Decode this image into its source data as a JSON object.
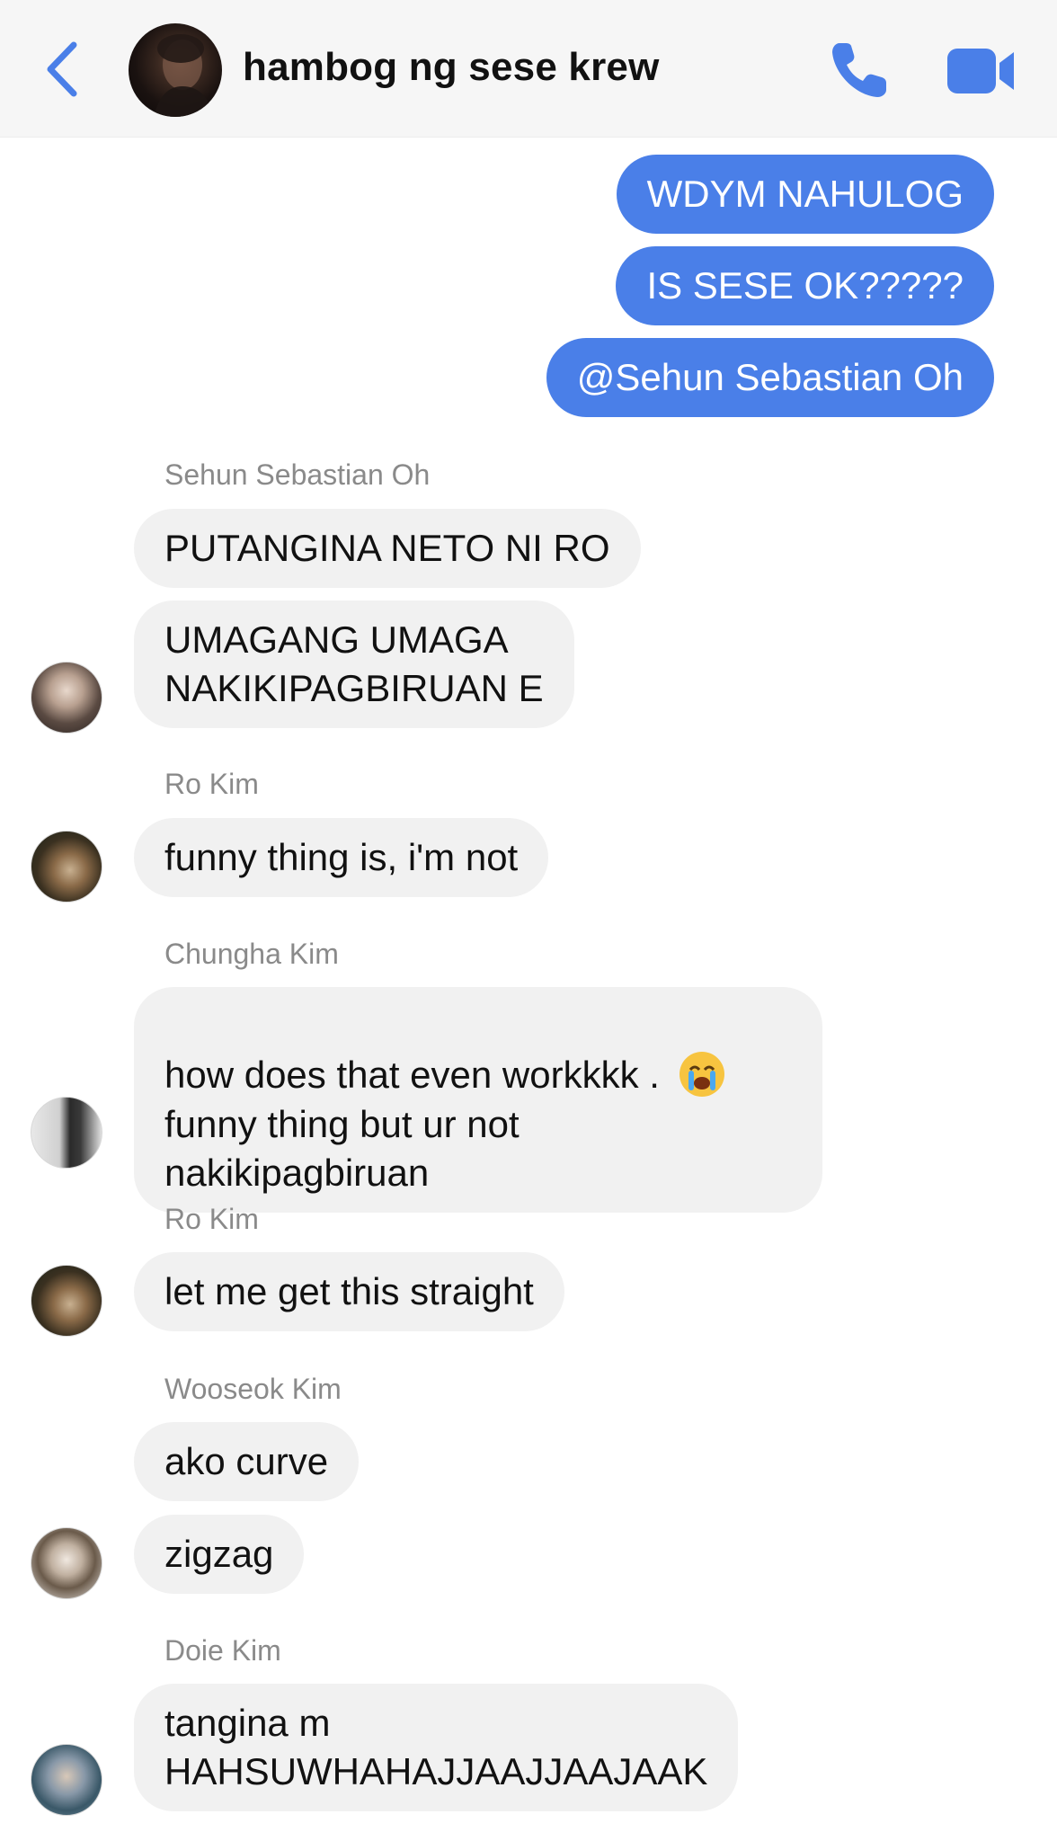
{
  "header": {
    "title": "hambog ng sese krew",
    "icons": {
      "back": "chevron-left-icon",
      "call": "phone-icon",
      "video": "video-camera-icon"
    },
    "accent_color": "#4a7fe8"
  },
  "messages": {
    "outgoing": [
      "WDYM NAHULOG",
      "IS SESE OK?????",
      "@Sehun Sebastian Oh"
    ],
    "sehun": {
      "sender": "Sehun Sebastian Oh",
      "lines": [
        "PUTANGINA NETO NI RO",
        "UMAGANG UMAGA\nNAKIKIPAGBIRUAN E"
      ]
    },
    "ro1": {
      "sender": "Ro Kim",
      "lines": [
        "funny thing is, i'm not"
      ]
    },
    "chungha": {
      "sender": "Chungha Kim",
      "line1": "how does that even workkkk . ",
      "line2": "funny thing but ur not\nnakikipagbiruan",
      "emoji": "loudly-crying-face-icon"
    },
    "ro2": {
      "sender": "Ro Kim",
      "lines": [
        "let me get this straight"
      ]
    },
    "wooseok": {
      "sender": "Wooseok Kim",
      "lines": [
        "ako curve",
        "zigzag"
      ]
    },
    "doie": {
      "sender": "Doie Kim",
      "lines": [
        "tangina m\nHAHSUWHAHAJJAAJJAAJAAK"
      ]
    }
  }
}
